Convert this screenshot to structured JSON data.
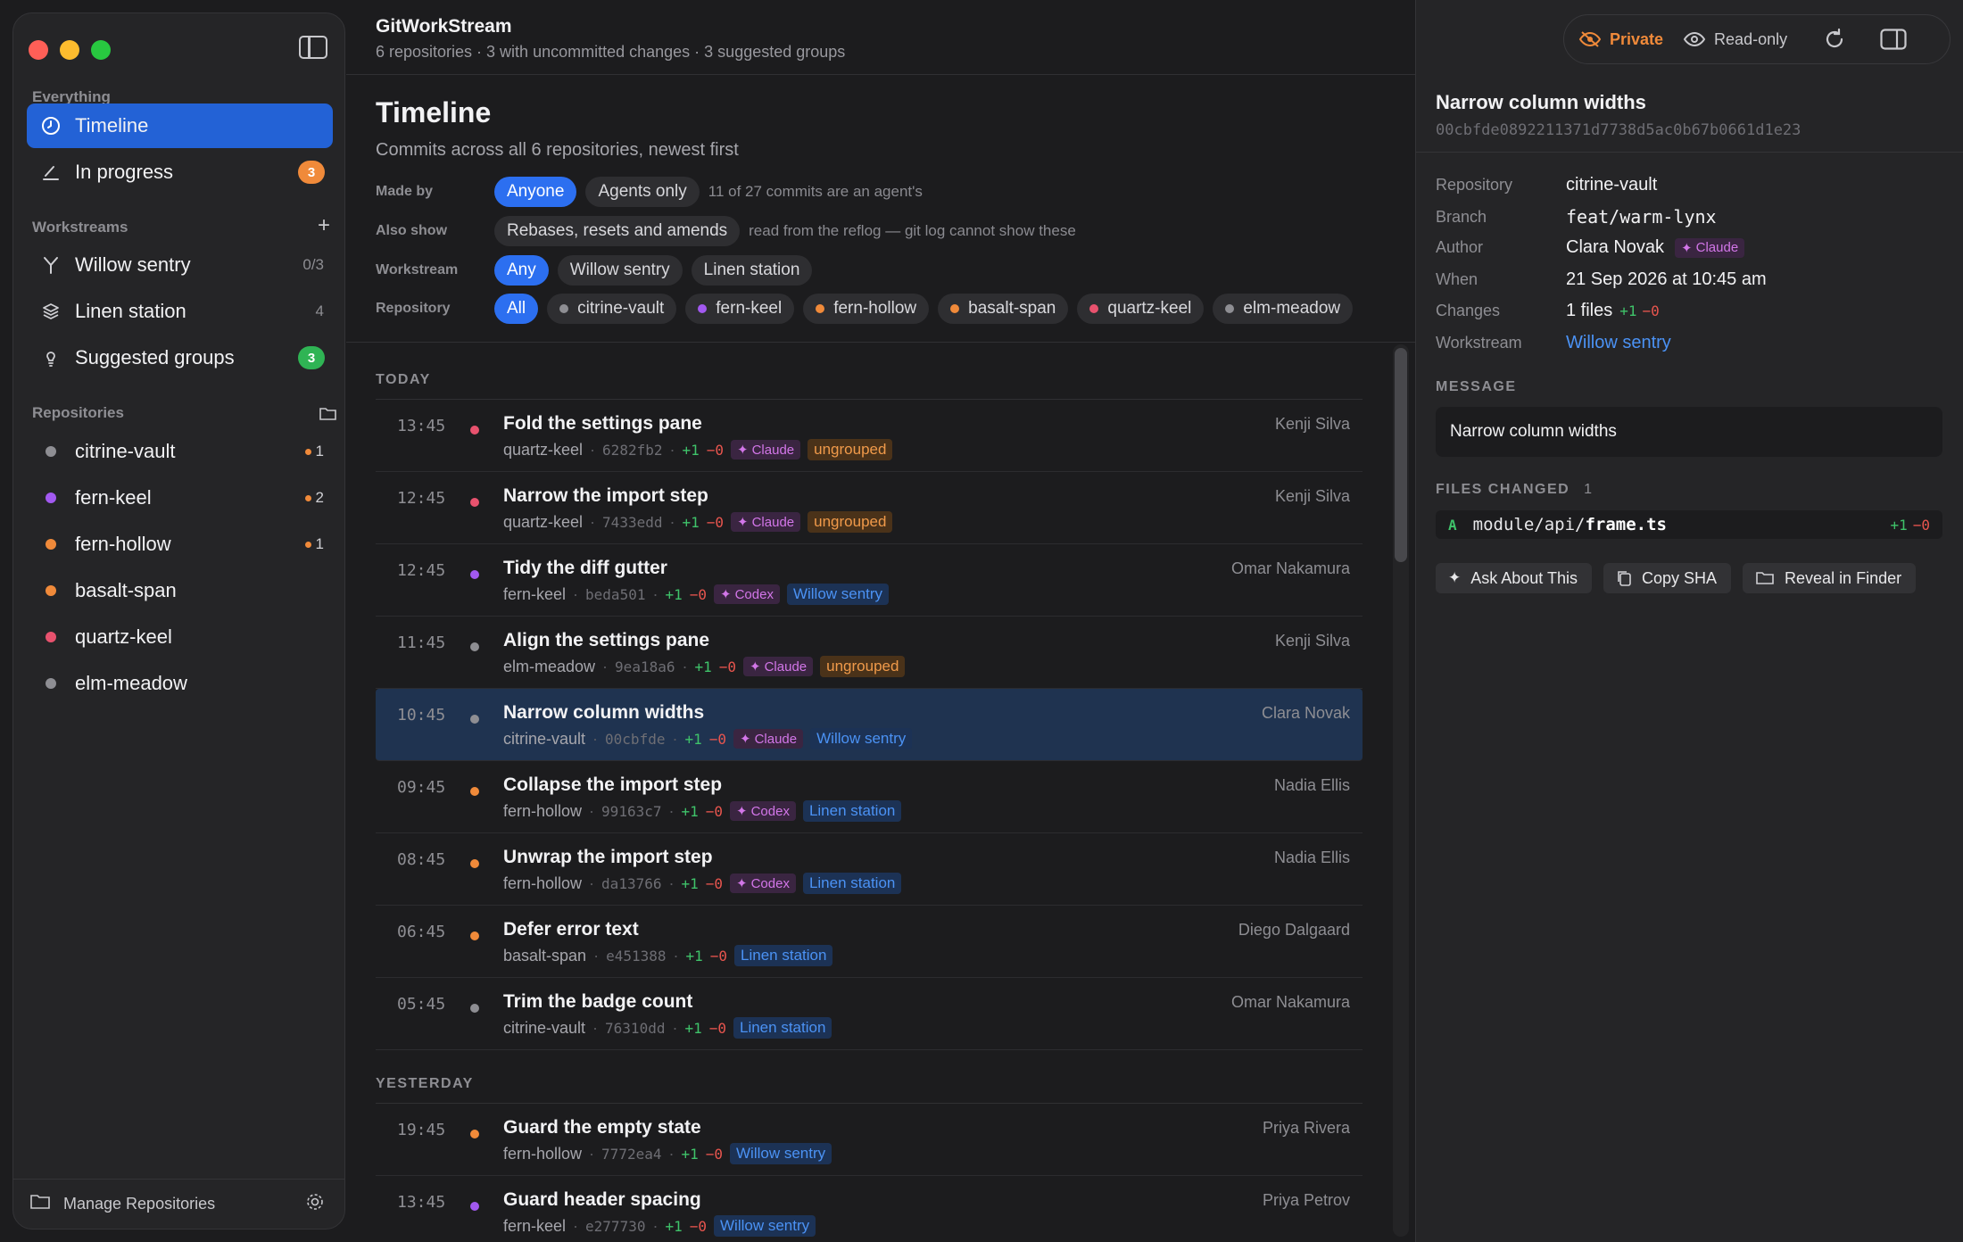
{
  "sidebar": {
    "everything_label": "Everything",
    "nav": [
      {
        "label": "Timeline",
        "active": true
      },
      {
        "label": "In progress",
        "badge": "3"
      }
    ],
    "workstreams_label": "Workstreams",
    "workstreams": [
      {
        "label": "Willow sentry",
        "count": "0/3"
      },
      {
        "label": "Linen station",
        "count": "4"
      },
      {
        "label": "Suggested groups",
        "badge": "3"
      }
    ],
    "repositories_label": "Repositories",
    "repositories": [
      {
        "name": "citrine-vault",
        "color": "#8e8e93",
        "dirty": "1"
      },
      {
        "name": "fern-keel",
        "color": "#a259f0",
        "dirty": "2"
      },
      {
        "name": "fern-hollow",
        "color": "#f08a3a",
        "dirty": "1"
      },
      {
        "name": "basalt-span",
        "color": "#f08a3a",
        "dirty": ""
      },
      {
        "name": "quartz-keel",
        "color": "#e8526e",
        "dirty": ""
      },
      {
        "name": "elm-meadow",
        "color": "#8e8e93",
        "dirty": ""
      }
    ],
    "footer_label": "Manage Repositories"
  },
  "header": {
    "title": "GitWorkStream",
    "subtitle": "6 repositories · 3 with uncommitted changes · 3 suggested groups"
  },
  "timeline": {
    "title": "Timeline",
    "subtitle": "Commits across all 6 repositories, newest first"
  },
  "filters": {
    "made_by": {
      "label": "Made by",
      "options": [
        "Anyone",
        "Agents only"
      ],
      "note": "11 of 27 commits are an agent's"
    },
    "also_show": {
      "label": "Also show",
      "options": [
        "Rebases, resets and amends"
      ],
      "note": "read from the reflog — git log cannot show these"
    },
    "workstream": {
      "label": "Workstream",
      "options": [
        "Any",
        "Willow sentry",
        "Linen station"
      ]
    },
    "repository": {
      "label": "Repository",
      "all": "All",
      "options": [
        {
          "name": "citrine-vault",
          "color": "#8e8e93"
        },
        {
          "name": "fern-keel",
          "color": "#a259f0"
        },
        {
          "name": "fern-hollow",
          "color": "#f08a3a"
        },
        {
          "name": "basalt-span",
          "color": "#f08a3a"
        },
        {
          "name": "quartz-keel",
          "color": "#e8526e"
        },
        {
          "name": "elm-meadow",
          "color": "#8e8e93"
        }
      ]
    }
  },
  "days": [
    {
      "label": "TODAY",
      "commits": [
        {
          "time": "13:45",
          "color": "#e8526e",
          "title": "Fold the settings pane",
          "repo": "quartz-keel",
          "sha": "6282fb2",
          "add": "+1",
          "del": "−0",
          "agent": "Claude",
          "tag": "ungrouped",
          "tag_kind": "ungrouped",
          "author": "Kenji Silva"
        },
        {
          "time": "12:45",
          "color": "#e8526e",
          "title": "Narrow the import step",
          "repo": "quartz-keel",
          "sha": "7433edd",
          "add": "+1",
          "del": "−0",
          "agent": "Claude",
          "tag": "ungrouped",
          "tag_kind": "ungrouped",
          "author": "Kenji Silva"
        },
        {
          "time": "12:45",
          "color": "#a259f0",
          "title": "Tidy the diff gutter",
          "repo": "fern-keel",
          "sha": "beda501",
          "add": "+1",
          "del": "−0",
          "agent": "Codex",
          "tag": "Willow sentry",
          "tag_kind": "ws",
          "author": "Omar Nakamura"
        },
        {
          "time": "11:45",
          "color": "#8e8e93",
          "title": "Align the settings pane",
          "repo": "elm-meadow",
          "sha": "9ea18a6",
          "add": "+1",
          "del": "−0",
          "agent": "Claude",
          "tag": "ungrouped",
          "tag_kind": "ungrouped",
          "author": "Kenji Silva"
        },
        {
          "time": "10:45",
          "color": "#8e8e93",
          "title": "Narrow column widths",
          "repo": "citrine-vault",
          "sha": "00cbfde",
          "add": "+1",
          "del": "−0",
          "agent": "Claude",
          "tag": "Willow sentry",
          "tag_kind": "ws",
          "author": "Clara Novak",
          "selected": true
        },
        {
          "time": "09:45",
          "color": "#f08a3a",
          "title": "Collapse the import step",
          "repo": "fern-hollow",
          "sha": "99163c7",
          "add": "+1",
          "del": "−0",
          "agent": "Codex",
          "tag": "Linen station",
          "tag_kind": "ws",
          "author": "Nadia Ellis"
        },
        {
          "time": "08:45",
          "color": "#f08a3a",
          "title": "Unwrap the import step",
          "repo": "fern-hollow",
          "sha": "da13766",
          "add": "+1",
          "del": "−0",
          "agent": "Codex",
          "tag": "Linen station",
          "tag_kind": "ws",
          "author": "Nadia Ellis"
        },
        {
          "time": "06:45",
          "color": "#f08a3a",
          "title": "Defer error text",
          "repo": "basalt-span",
          "sha": "e451388",
          "add": "+1",
          "del": "−0",
          "agent": "",
          "tag": "Linen station",
          "tag_kind": "ws",
          "author": "Diego Dalgaard"
        },
        {
          "time": "05:45",
          "color": "#8e8e93",
          "title": "Trim the badge count",
          "repo": "citrine-vault",
          "sha": "76310dd",
          "add": "+1",
          "del": "−0",
          "agent": "",
          "tag": "Linen station",
          "tag_kind": "ws",
          "author": "Omar Nakamura"
        }
      ]
    },
    {
      "label": "YESTERDAY",
      "commits": [
        {
          "time": "19:45",
          "color": "#f08a3a",
          "title": "Guard the empty state",
          "repo": "fern-hollow",
          "sha": "7772ea4",
          "add": "+1",
          "del": "−0",
          "agent": "",
          "tag": "Willow sentry",
          "tag_kind": "ws",
          "author": "Priya Rivera"
        },
        {
          "time": "13:45",
          "color": "#a259f0",
          "title": "Guard header spacing",
          "repo": "fern-keel",
          "sha": "e277730",
          "add": "+1",
          "del": "−0",
          "agent": "",
          "tag": "Willow sentry",
          "tag_kind": "ws",
          "author": "Priya Petrov"
        }
      ]
    }
  ],
  "toolbar": {
    "private_label": "Private",
    "readonly_label": "Read-only"
  },
  "detail": {
    "title": "Narrow column widths",
    "sha": "00cbfde0892211371d7738d5ac0b67b0661d1e23",
    "fields": {
      "repository_k": "Repository",
      "repository_v": "citrine-vault",
      "branch_k": "Branch",
      "branch_v": "feat/warm-lynx",
      "author_k": "Author",
      "author_v": "Clara Novak",
      "author_agent": "Claude",
      "when_k": "When",
      "when_v": "21 Sep 2026 at 10:45 am",
      "changes_k": "Changes",
      "changes_v": "1 files",
      "changes_add": "+1",
      "changes_del": "−0",
      "workstream_k": "Workstream",
      "workstream_v": "Willow sentry"
    },
    "message_label": "MESSAGE",
    "message": "Narrow column widths",
    "files_label": "FILES CHANGED",
    "files_count": "1",
    "file": {
      "status": "A",
      "dir": "module/api/",
      "name": "frame.ts",
      "add": "+1",
      "del": "−0"
    },
    "actions": {
      "ask": "Ask About This",
      "copy": "Copy SHA",
      "reveal": "Reveal in Finder"
    }
  },
  "colors": {
    "accent": "#2362d6",
    "private": "#f08a3a",
    "link": "#4b92f4",
    "add": "#3fc36a",
    "del": "#e8554e",
    "agent": "#d276e8"
  }
}
